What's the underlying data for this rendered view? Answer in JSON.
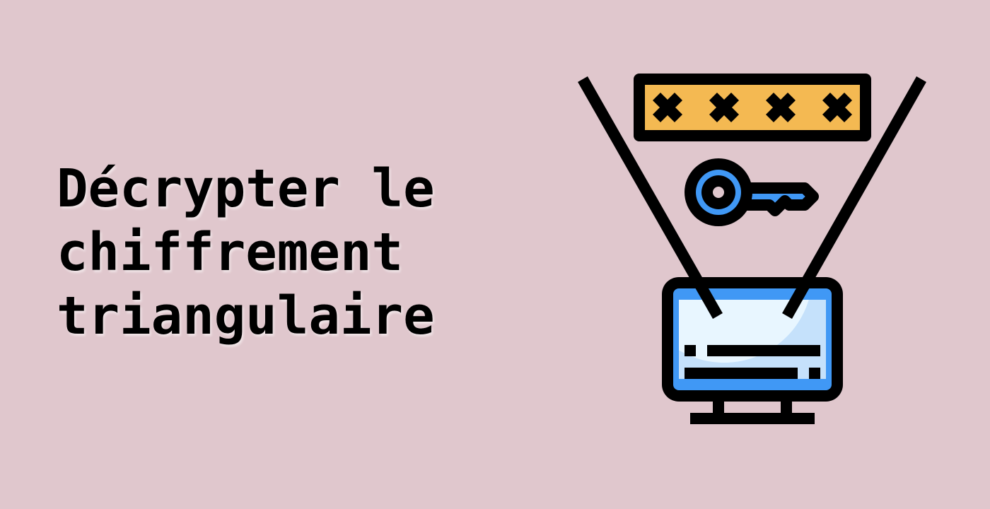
{
  "title": {
    "lines": [
      "Décrypter le",
      "chiffrement",
      "triangulaire"
    ]
  },
  "illustration": {
    "icons": [
      "password-field-icon",
      "key-icon",
      "computer-monitor-icon",
      "projection-lines"
    ],
    "colors": {
      "background": "#E0C7CD",
      "password_fill": "#F4B952",
      "key_blue": "#4098F5",
      "screen_frame": "#4098F5",
      "screen_light": "#E8F6FF",
      "screen_shade": "#C5E1FB",
      "outline": "#000000"
    }
  }
}
